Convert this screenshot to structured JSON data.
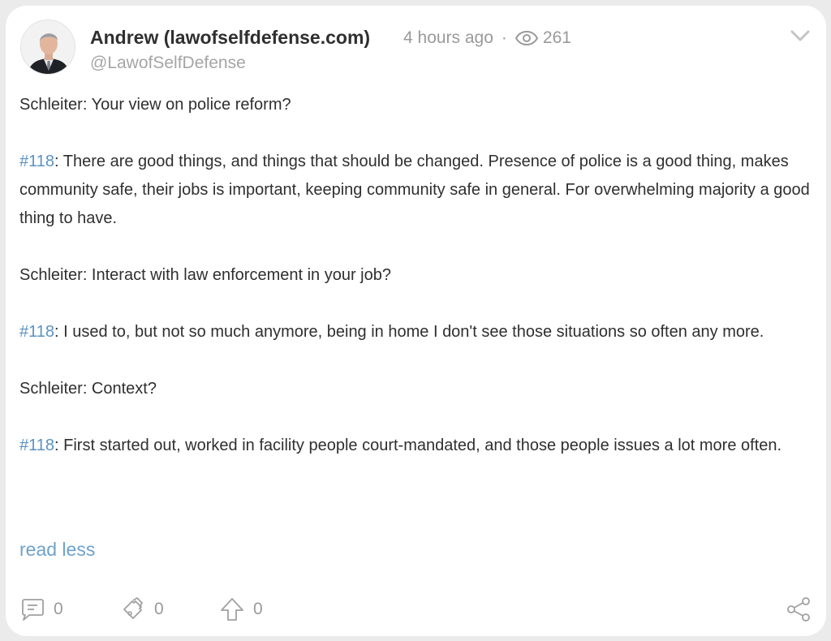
{
  "post": {
    "author_name": "Andrew (lawofselfdefense.com)",
    "time_ago": "4 hours ago",
    "separator": "·",
    "views": "261",
    "handle": "@LawofSelfDefense",
    "paragraphs": [
      {
        "speaker": "Schleiter",
        "text": ": Your view on police reform?",
        "is_tag": false
      },
      {
        "speaker": "#118",
        "text": ": There are good things, and things that should be changed. Presence of police is a good thing, makes community safe, their jobs is important, keeping community safe in general. For overwhelming majority a good thing to have.",
        "is_tag": true
      },
      {
        "speaker": "Schleiter",
        "text": ": Interact with law enforcement in your job?",
        "is_tag": false
      },
      {
        "speaker": "#118",
        "text": ": I used to, but not so much anymore, being in home I don't see those situations so often any more.",
        "is_tag": true
      },
      {
        "speaker": "Schleiter",
        "text": ": Context?",
        "is_tag": false
      },
      {
        "speaker": "#118",
        "text": ": First started out, worked in facility people court-mandated, and those people issues a lot more often.",
        "is_tag": true
      }
    ],
    "read_less": "read less"
  },
  "actions": {
    "comments": "0",
    "reposts": "0",
    "upvotes": "0"
  },
  "icons": {
    "views": "eye-icon",
    "menu": "chevron-down-icon",
    "comment": "comment-icon",
    "repost": "repost-icon",
    "upvote": "upvote-arrow-icon",
    "share": "share-icon"
  },
  "colors": {
    "tag": "#5b92c2",
    "link": "#6ea2cc",
    "muted": "#9a9a9a"
  }
}
